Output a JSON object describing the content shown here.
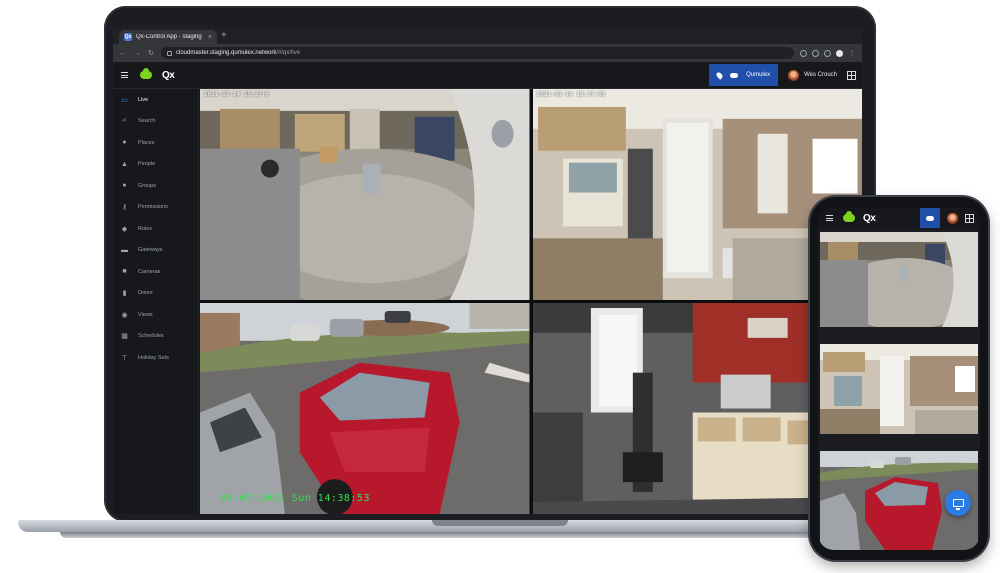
{
  "browser": {
    "tab_title": "Qx-Control App - staging",
    "tab_favicon": "Qx",
    "url_host": "cloudmaster.staging.qumulex.network",
    "url_path": "/#/qx/live"
  },
  "app": {
    "logo_text": "Qx",
    "organization": "Qumulex",
    "user_name": "Wes Crouch",
    "brand_color": "#7ed321",
    "accent_color": "#1f4fa8"
  },
  "sidebar": {
    "items": [
      {
        "label": "Live",
        "icon": "monitor-icon",
        "active": true
      },
      {
        "label": "Search",
        "icon": "search-icon"
      },
      {
        "label": "Places",
        "icon": "pin-icon"
      },
      {
        "label": "People",
        "icon": "person-icon"
      },
      {
        "label": "Groups",
        "icon": "group-icon"
      },
      {
        "label": "Permissions",
        "icon": "key-icon"
      },
      {
        "label": "Roles",
        "icon": "role-icon"
      },
      {
        "label": "Gateways",
        "icon": "gateway-icon"
      },
      {
        "label": "Cameras",
        "icon": "camera-icon"
      },
      {
        "label": "Doors",
        "icon": "door-icon"
      },
      {
        "label": "Views",
        "icon": "eye-icon"
      },
      {
        "label": "Schedules",
        "icon": "calendar-icon"
      },
      {
        "label": "Holiday Sets",
        "icon": "holiday-icon"
      }
    ]
  },
  "cameras": {
    "cam1_timestamp": "2021-03-14 15:37:0",
    "cam2_timestamp": "2021-03-14 15:37:03",
    "cam3_timestamp": "03-07-2021 Sun 14:38:53"
  },
  "phone": {
    "logo_text": "Qx"
  }
}
